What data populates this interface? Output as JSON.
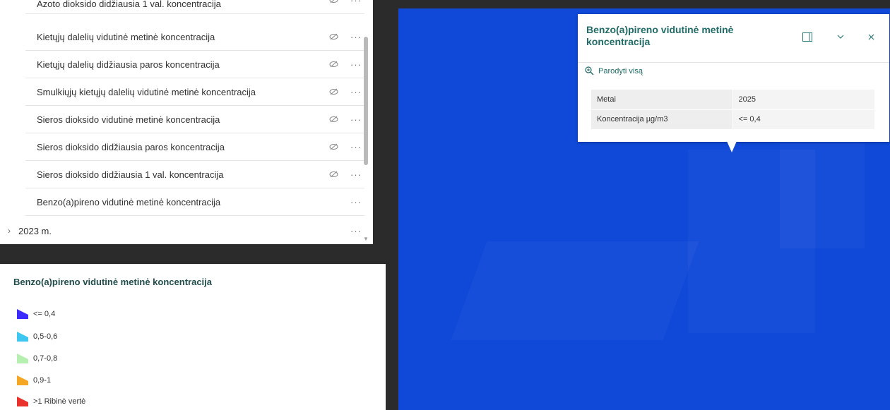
{
  "layer_list": {
    "layers": [
      {
        "label": "Azoto dioksido didžiausia 1 val. koncentracija",
        "hidden": true,
        "more": "···"
      },
      {
        "label": "Kietųjų dalelių vidutinė metinė koncentracija",
        "hidden": true,
        "more": "···"
      },
      {
        "label": "Kietųjų dalelių didžiausia paros koncentracija",
        "hidden": true,
        "more": "···"
      },
      {
        "label": "Smulkiųjų kietųjų dalelių vidutinė metinė koncentracija",
        "hidden": true,
        "more": "···"
      },
      {
        "label": "Sieros dioksido vidutinė metinė koncentracija",
        "hidden": true,
        "more": "···"
      },
      {
        "label": "Sieros dioksido didžiausia paros koncentracija",
        "hidden": true,
        "more": "···"
      },
      {
        "label": "Sieros dioksido didžiausia 1 val. koncentracija",
        "hidden": true,
        "more": "···"
      },
      {
        "label": "Benzo(a)pireno vidutinė metinė koncentracija",
        "hidden": false,
        "more": "···"
      }
    ],
    "group": {
      "label": "2023 m.",
      "chevron": "›",
      "more": "···"
    }
  },
  "legend": {
    "title": "Benzo(a)pireno vidutinė metinė koncentracija",
    "items": [
      {
        "label": "<= 0,4",
        "color": "#3b2bff"
      },
      {
        "label": "0,5-0,6",
        "color": "#3cc6f0"
      },
      {
        "label": "0,7-0,8",
        "color": "#b5f0b0"
      },
      {
        "label": "0,9-1",
        "color": "#f5a623"
      },
      {
        "label": ">1 Ribinė vertė",
        "color": "#e8322b"
      }
    ]
  },
  "popup": {
    "title": "Benzo(a)pireno vidutinė metinė koncentracija",
    "zoom_label": "Parodyti visą",
    "icons": {
      "dock": "dock-icon",
      "collapse": "chevron-down-icon",
      "close": "close-icon",
      "zoom": "zoom-in-icon"
    },
    "rows": [
      {
        "key": "Metai",
        "value": "2025"
      },
      {
        "key": "Koncentracija µg/m3",
        "value": "<= 0,4"
      }
    ]
  },
  "colors": {
    "map_fill": "#1049d8",
    "accent": "#1f6b66"
  }
}
